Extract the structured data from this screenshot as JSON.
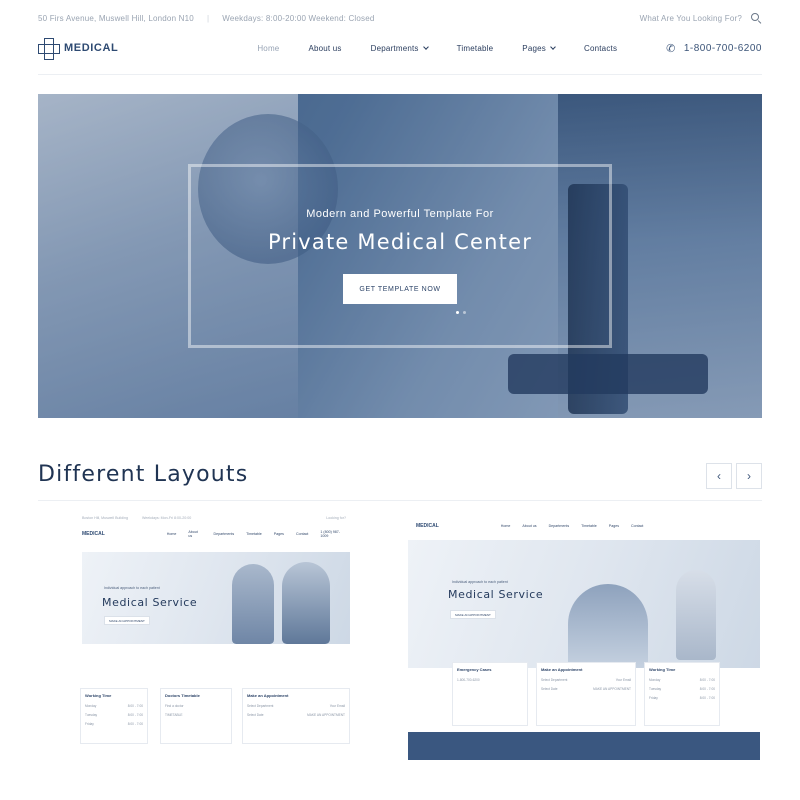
{
  "topbar": {
    "address": "50 Firs Avenue, Muswell Hill, London N10",
    "hours": "Weekdays: 8:00-20:00 Weekend: Closed",
    "search_prompt": "What Are You Looking For?"
  },
  "nav": {
    "logo": "MEDICAL",
    "items": [
      {
        "label": "Home",
        "active": true,
        "dropdown": false
      },
      {
        "label": "About us",
        "active": false,
        "dropdown": false
      },
      {
        "label": "Departments",
        "active": false,
        "dropdown": true
      },
      {
        "label": "Timetable",
        "active": false,
        "dropdown": false
      },
      {
        "label": "Pages",
        "active": false,
        "dropdown": true
      },
      {
        "label": "Contacts",
        "active": false,
        "dropdown": false
      }
    ],
    "phone": "1-800-700-6200"
  },
  "hero": {
    "eyebrow": "Modern and Powerful Template For",
    "title": "Private Medical Center",
    "cta": "GET TEMPLATE NOW",
    "slides": 2,
    "active_slide": 1
  },
  "layouts": {
    "title": "Different Layouts",
    "prev": "‹",
    "next": "›",
    "left_preview": {
      "topbar_left": "Boston Hill, Muswell Building",
      "topbar_mid": "Weekdays: Mon-Fri 8:00-20:00",
      "topbar_right": "Looking for?",
      "logo": "MEDICAL",
      "menu": [
        "Home",
        "About us",
        "Departments",
        "Timetable",
        "Pages",
        "Contact"
      ],
      "phone": "1 (800) 987-1009",
      "hero_sub": "Individual approach to each patient",
      "hero_title": "Medical Service",
      "hero_btn": "MAKE AN APPOINTMENT",
      "cards": [
        {
          "title": "Working Time",
          "rows": [
            [
              "Monday",
              "8:00 - 7:00"
            ],
            [
              "Tuesday",
              "8:00 - 7:00"
            ],
            [
              "Friday",
              "8:00 - 7:00"
            ]
          ]
        },
        {
          "title": "Doctors Timetable",
          "rows": [
            [
              "Find a doctor",
              ""
            ],
            [
              "TIMETABLE",
              ""
            ]
          ]
        },
        {
          "title": "Make an Appointment",
          "rows": [
            [
              "Select Department",
              "Your Email"
            ],
            [
              "Select Date",
              "MAKE AN APPOINTMENT"
            ]
          ]
        }
      ]
    },
    "right_preview": {
      "logo": "MEDICAL",
      "menu": [
        "Home",
        "About us",
        "Departments",
        "Timetable",
        "Pages",
        "Contact"
      ],
      "hero_sub": "Individual approach to each patient",
      "hero_title": "Medical Service",
      "hero_btn": "MAKE AN APPOINTMENT",
      "cards": [
        {
          "title": "Emergency Cases",
          "rows": [
            [
              "1-800-700-6200",
              ""
            ]
          ]
        },
        {
          "title": "Make an Appointment",
          "rows": [
            [
              "Select Department",
              "Your Email"
            ],
            [
              "Select Date",
              "MAKE AN APPOINTMENT"
            ]
          ]
        },
        {
          "title": "Working Time",
          "rows": [
            [
              "Monday",
              "8:00 - 7:00"
            ],
            [
              "Tuesday",
              "8:00 - 7:00"
            ],
            [
              "Friday",
              "8:00 - 7:00"
            ]
          ]
        }
      ]
    }
  },
  "colors": {
    "brand": "#2e4a72",
    "text_dark": "#203453",
    "muted": "#9aa4b2",
    "hero_tint": "#4f6e96"
  }
}
